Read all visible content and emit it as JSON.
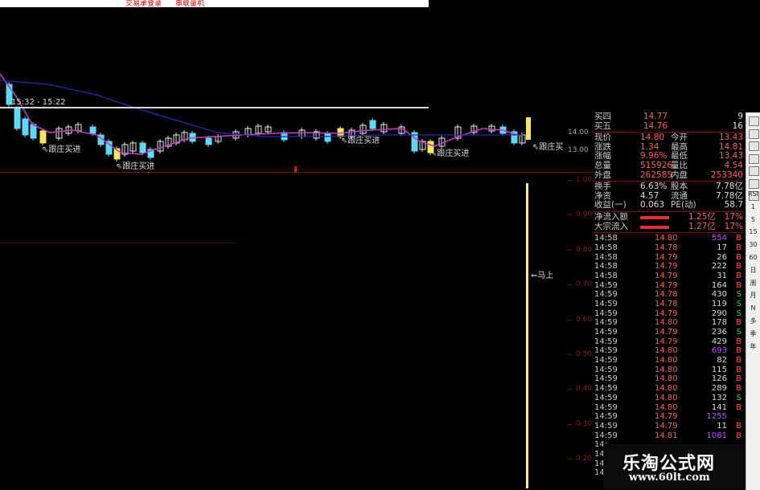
{
  "toolbar": {
    "item1": "交易承登录",
    "item2": "串联量机"
  },
  "chart": {
    "time_range": "15:32 - 15:22",
    "annotations": [
      "跟庄买进",
      "跟庄买进",
      "跟庄买进",
      "跟庄买进",
      "跟庄买",
      "马上"
    ],
    "price_ticks": [
      "14.00",
      "13.00"
    ],
    "indicator_ticks": [
      "1.00",
      "0.90",
      "0.80",
      "0.70",
      "0.60",
      "0.50",
      "0.40",
      "0.30",
      "0.20"
    ],
    "colors": {
      "up": "#e8e8e8",
      "down": "#5fd7f5",
      "signal": "#f5e55f",
      "ma": "#c03cc0",
      "ma2": "#2a2ab0"
    }
  },
  "quote": {
    "orderbook": [
      {
        "label": "买四",
        "price": "14.77",
        "vol": "9"
      },
      {
        "label": "买五",
        "price": "14.76",
        "vol": "16"
      }
    ],
    "stats": [
      {
        "l1": "现价",
        "v1": "14.80",
        "l2": "今开",
        "v2": "13.43"
      },
      {
        "l1": "涨跌",
        "v1": "1.34",
        "l2": "最高",
        "v2": "14.81"
      },
      {
        "l1": "涨幅",
        "v1": "9.96%",
        "l2": "最低",
        "v2": "13.43"
      },
      {
        "l1": "总量",
        "v1": "515926",
        "l2": "量比",
        "v2": "4.54"
      },
      {
        "l1": "外盘",
        "v1": "262585",
        "l2": "内盘",
        "v2": "253340"
      }
    ],
    "stats2": [
      {
        "l1": "换手",
        "v1": "6.63%",
        "l2": "股本",
        "v2": "7.78亿"
      },
      {
        "l1": "净资",
        "v1": "4.57",
        "l2": "流通",
        "v2": "7.78亿"
      },
      {
        "l1": "收益(一)",
        "v1": "0.063",
        "l2": "PE(动)",
        "v2": "58.7"
      }
    ],
    "flows": [
      {
        "label": "净流入额",
        "value": "1.25亿",
        "pct": "17%"
      },
      {
        "label": "大宗流入",
        "value": "1.27亿",
        "pct": "17%"
      }
    ],
    "ticks": [
      {
        "t": "14:58",
        "p": "14.80",
        "v": "554",
        "d": "B"
      },
      {
        "t": "14:58",
        "p": "14.78",
        "v": "17",
        "d": "B"
      },
      {
        "t": "14:58",
        "p": "14.79",
        "v": "26",
        "d": "B"
      },
      {
        "t": "14:58",
        "p": "14.79",
        "v": "222",
        "d": "B"
      },
      {
        "t": "14:58",
        "p": "14.79",
        "v": "31",
        "d": "B"
      },
      {
        "t": "14:59",
        "p": "14.79",
        "v": "164",
        "d": "B"
      },
      {
        "t": "14:59",
        "p": "14.78",
        "v": "430",
        "d": "S"
      },
      {
        "t": "14:59",
        "p": "14.78",
        "v": "119",
        "d": "S"
      },
      {
        "t": "14:59",
        "p": "14.79",
        "v": "290",
        "d": "S"
      },
      {
        "t": "14:59",
        "p": "14.80",
        "v": "178",
        "d": "B"
      },
      {
        "t": "14:59",
        "p": "14.79",
        "v": "236",
        "d": "S"
      },
      {
        "t": "14:59",
        "p": "14.79",
        "v": "429",
        "d": "B"
      },
      {
        "t": "14:59",
        "p": "14.80",
        "v": "693",
        "d": "B"
      },
      {
        "t": "14:59",
        "p": "14.80",
        "v": "82",
        "d": "B"
      },
      {
        "t": "14:59",
        "p": "14.80",
        "v": "115",
        "d": "B"
      },
      {
        "t": "14:59",
        "p": "14.80",
        "v": "126",
        "d": "B"
      },
      {
        "t": "14:59",
        "p": "14.80",
        "v": "289",
        "d": "B"
      },
      {
        "t": "14:59",
        "p": "14.80",
        "v": "132",
        "d": "S"
      },
      {
        "t": "14:59",
        "p": "14.80",
        "v": "141",
        "d": "B"
      },
      {
        "t": "14:59",
        "p": "14.79",
        "v": "1255",
        "d": ""
      },
      {
        "t": "14:59",
        "p": "14.79",
        "v": "11",
        "d": "B"
      },
      {
        "t": "14:59",
        "p": "14.81",
        "v": "1081",
        "d": "B"
      },
      {
        "t": "14:",
        "p": "",
        "v": "",
        "d": ""
      },
      {
        "t": "14:",
        "p": "",
        "v": "",
        "d": ""
      },
      {
        "t": "14:",
        "p": "",
        "v": "",
        "d": ""
      },
      {
        "t": "14:",
        "p": "",
        "v": "",
        "d": ""
      }
    ]
  },
  "sidebar": {
    "items": [
      "RSI",
      "1",
      "5",
      "15",
      "30",
      "60",
      "日",
      "周",
      "月",
      "N",
      "多",
      "季",
      "年"
    ]
  },
  "watermark": {
    "title": "乐淘公式网",
    "url": "www.60lt.com"
  }
}
